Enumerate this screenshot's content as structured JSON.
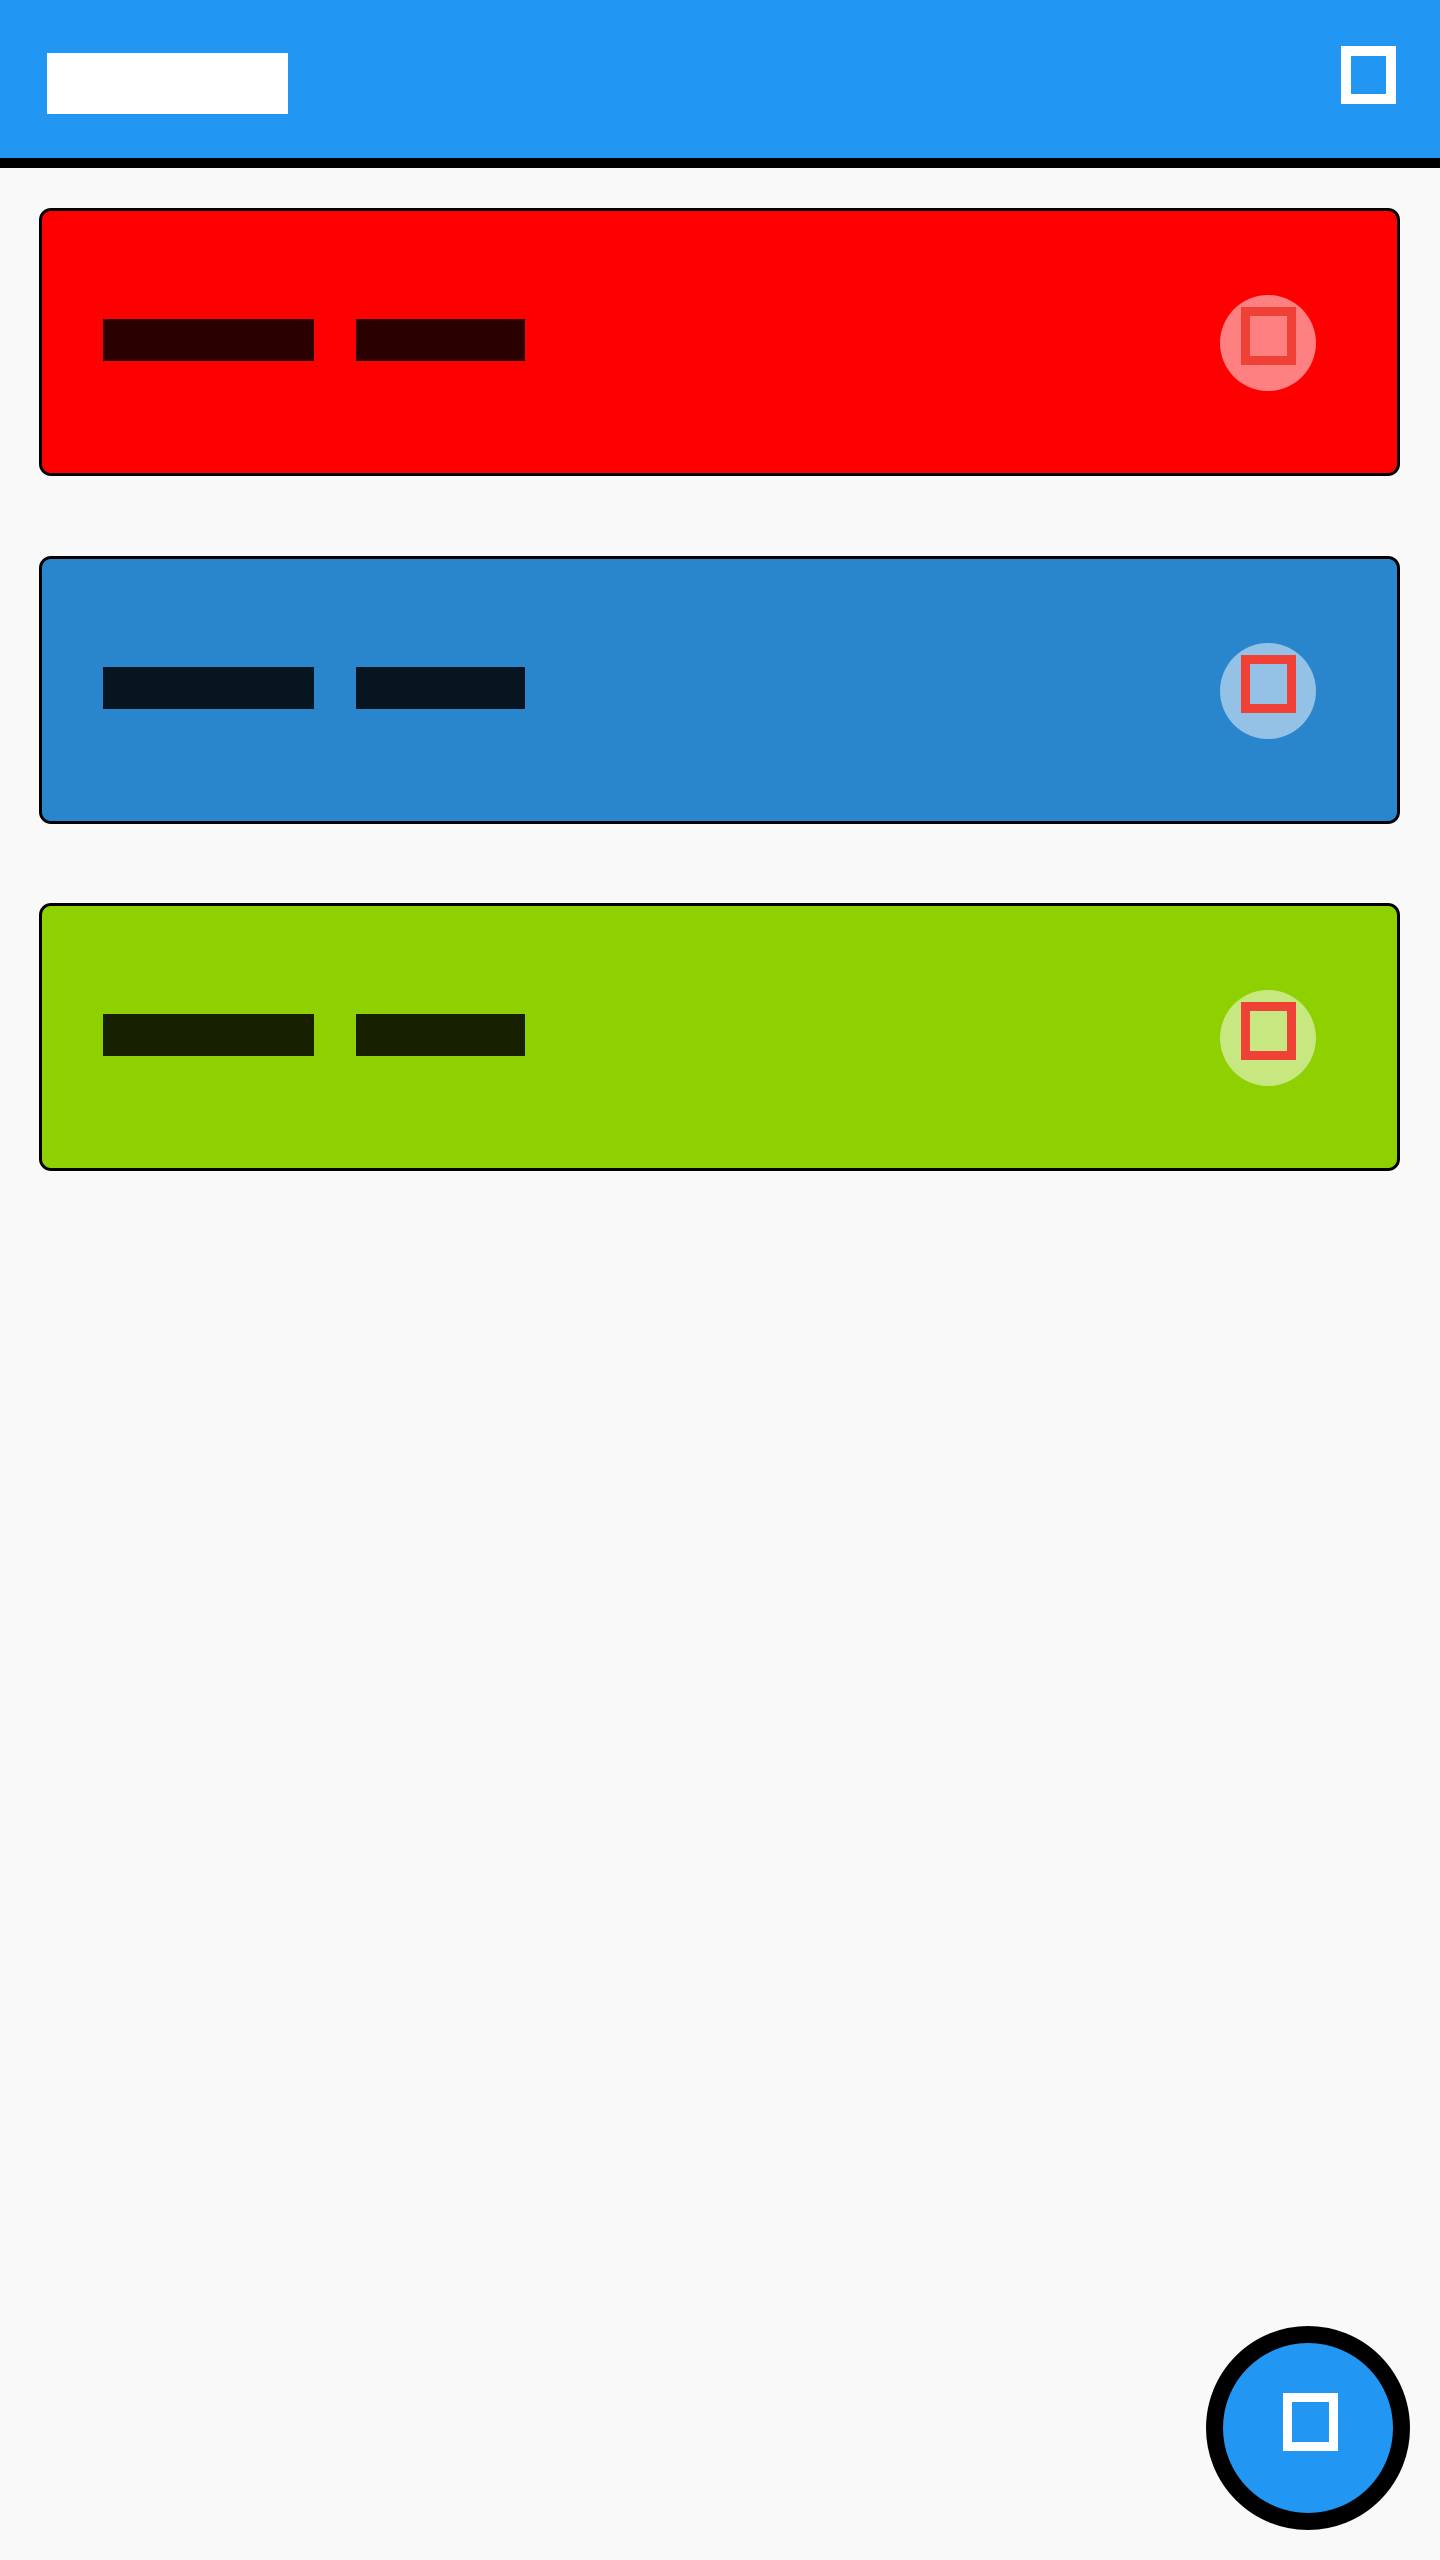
{
  "app_bar": {
    "title": "",
    "action_icon": "square-icon",
    "background": "#2196f3"
  },
  "cards": [
    {
      "color": "#ff0000",
      "text_color": "#2a0000",
      "title_word1": "",
      "title_word2": "",
      "toggle_icon": "square-icon",
      "toggle_fill": "#ff8080"
    },
    {
      "color": "#2986cc",
      "text_color": "#071520",
      "title_word1": "",
      "title_word2": "",
      "toggle_icon": "square-icon",
      "toggle_fill": "#94c2e6"
    },
    {
      "color": "#8fd000",
      "text_color": "#172000",
      "title_word1": "",
      "title_word2": "",
      "toggle_icon": "square-icon",
      "toggle_fill": "#c7e780"
    }
  ],
  "fab": {
    "icon": "square-icon",
    "background": "#2196f3"
  }
}
